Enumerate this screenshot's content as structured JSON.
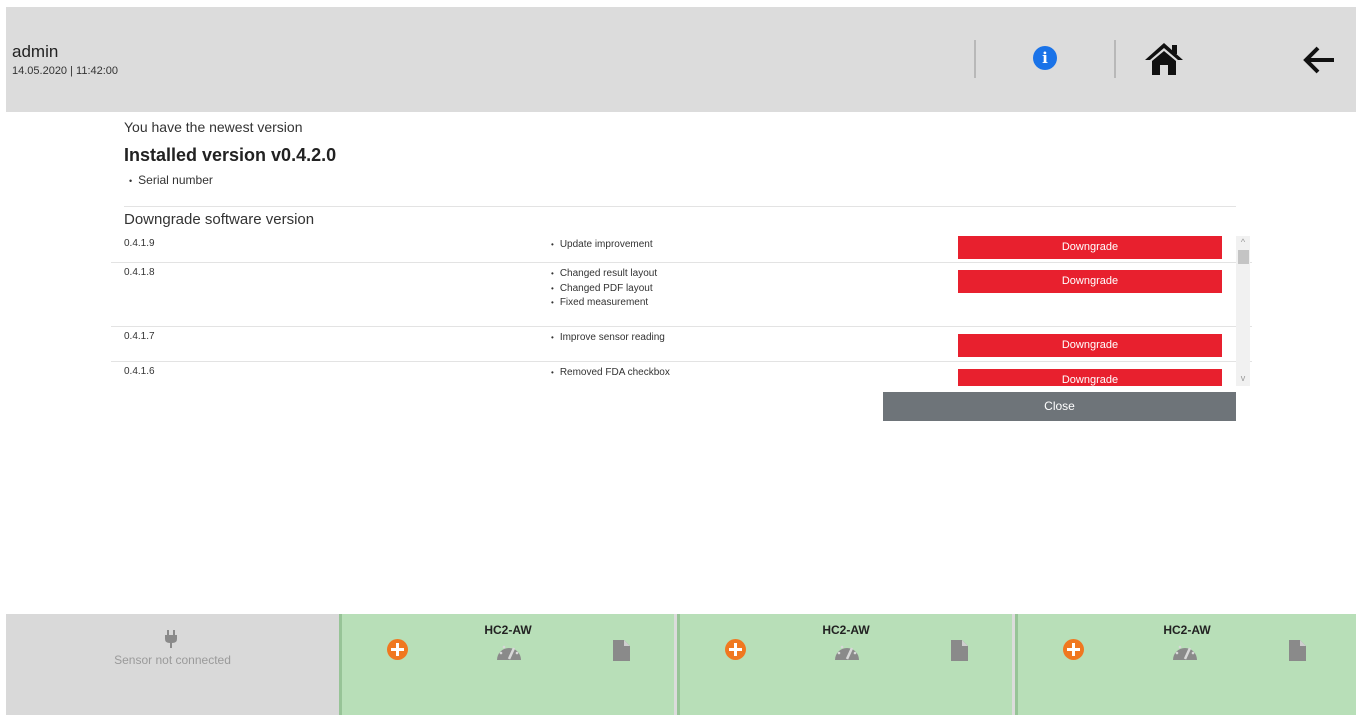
{
  "header": {
    "user": "admin",
    "datetime": "14.05.2020 | 11:42:00",
    "icons": {
      "info": "info-icon",
      "home": "home-icon",
      "back": "arrow-left-icon"
    },
    "colors": {
      "info": "#1a73e8",
      "background": "#dcdcdc"
    }
  },
  "status": {
    "newest": "You have the newest version",
    "installed": "Installed version v0.4.2.0",
    "serial_label": "Serial number"
  },
  "downgrade": {
    "title": "Downgrade software version",
    "button_color": "#e8202e",
    "versions": [
      {
        "version": "0.4.1.9",
        "notes": [
          "Update improvement"
        ],
        "button": "Downgrade"
      },
      {
        "version": "0.4.1.8",
        "notes": [
          "Changed result layout",
          "Changed PDF layout",
          "Fixed measurement"
        ],
        "button": "Downgrade"
      },
      {
        "version": "0.4.1.7",
        "notes": [
          "Improve sensor reading"
        ],
        "button": "Downgrade"
      },
      {
        "version": "0.4.1.6",
        "notes": [
          "Removed FDA checkbox"
        ],
        "button": "Downgrade"
      }
    ],
    "close": "Close"
  },
  "footer": {
    "disconnected": {
      "text": "Sensor not connected",
      "icon": "plug-icon"
    },
    "sensors": [
      {
        "name": "HC2-AW",
        "icons": [
          "plus-circle-icon",
          "gauge-icon",
          "document-icon"
        ]
      },
      {
        "name": "HC2-AW",
        "icons": [
          "plus-circle-icon",
          "gauge-icon",
          "document-icon"
        ]
      },
      {
        "name": "HC2-AW",
        "icons": [
          "plus-circle-icon",
          "gauge-icon",
          "document-icon"
        ]
      }
    ],
    "colors": {
      "connected": "#b8dfb8",
      "add": "#f07820"
    }
  }
}
